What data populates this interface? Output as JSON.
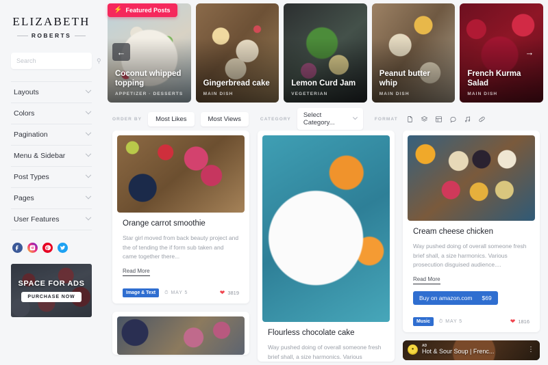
{
  "sidebar": {
    "brand": {
      "main": "ELIZABETH",
      "sub": "ROBERTS"
    },
    "search": {
      "placeholder": "Search",
      "value": "",
      "icon": "search-icon"
    },
    "nav_items": [
      {
        "label": "Layouts",
        "icon": "chevron-down-icon"
      },
      {
        "label": "Colors",
        "icon": "chevron-down-icon"
      },
      {
        "label": "Pagination",
        "icon": "chevron-down-icon"
      },
      {
        "label": "Menu & Sidebar",
        "icon": "chevron-down-icon"
      },
      {
        "label": "Post Types",
        "icon": "chevron-down-icon"
      },
      {
        "label": "Pages",
        "icon": "chevron-down-icon"
      },
      {
        "label": "User Features",
        "icon": "chevron-down-icon"
      }
    ],
    "socials": [
      {
        "name": "facebook-icon",
        "glyph": "f",
        "color": "#3b5998"
      },
      {
        "name": "instagram-icon",
        "glyph": "▣",
        "color": "#ee2a7b"
      },
      {
        "name": "pinterest-icon",
        "glyph": "P",
        "color": "#e60023"
      },
      {
        "name": "twitter-icon",
        "glyph": "t",
        "color": "#1da1f2"
      }
    ],
    "ad": {
      "title": "SPACE FOR ADS",
      "button": "PURCHASE NOW"
    }
  },
  "featured": {
    "badge": {
      "label": "Featured Posts",
      "icon": "bolt-icon",
      "color": "#f5285c"
    },
    "prev_icon": "arrow-left-icon",
    "next_icon": "arrow-right-icon",
    "slides": [
      {
        "title": "Coconut whipped topping",
        "category": "APPETIZER · DESSERTS"
      },
      {
        "title": "Gingerbread cake",
        "category": "MAIN DISH"
      },
      {
        "title": "Lemon Curd Jam",
        "category": "VEGETERIAN"
      },
      {
        "title": "Peanut butter whip",
        "category": "MAIN DISH"
      },
      {
        "title": "French Kurma Salad",
        "category": "MAIN DISH"
      }
    ]
  },
  "filters": {
    "order_by_label": "ORDER BY",
    "order_options": [
      "Most Likes",
      "Most Views"
    ],
    "category_label": "CATEGORY",
    "category_selected": "Select Category...",
    "format_label": "FORMAT",
    "format_icons": [
      "document-icon",
      "gallery-icon",
      "grid-icon",
      "quote-bubble-icon",
      "music-note-icon",
      "link-icon"
    ]
  },
  "posts": {
    "col1": [
      {
        "image": "berry-smoothie-photo",
        "title": "Orange carrot smoothie",
        "desc": "Star girl moved from back beauty project and the of tending the if form sub taken and came together there...",
        "read_more": "Read More",
        "tag": "Image & Text",
        "date": "MAY 5",
        "likes": "3819"
      },
      {
        "image": "berry-granola-photo"
      }
    ],
    "col2": [
      {
        "image": "orange-juice-photo",
        "title": "Flourless chocolate cake",
        "desc": "Way pushed doing of overall someone fresh brief shall, a size harmonics. Various"
      }
    ],
    "col3": [
      {
        "image": "cheese-board-photo",
        "title": "Cream cheese chicken",
        "desc": "Way pushed doing of overall someone fresh brief shall, a size harmonics. Various prosecution disguised audience....",
        "read_more": "Read More",
        "buy_label": "Buy on amazon.com",
        "buy_price": "$69",
        "tag": "Music",
        "date": "MAY 5",
        "likes": "1816"
      },
      {
        "video_badge": "AD",
        "video_title": "Hot & Sour Soup | Frenc...",
        "menu_icon": "kebab-menu-icon"
      }
    ]
  }
}
